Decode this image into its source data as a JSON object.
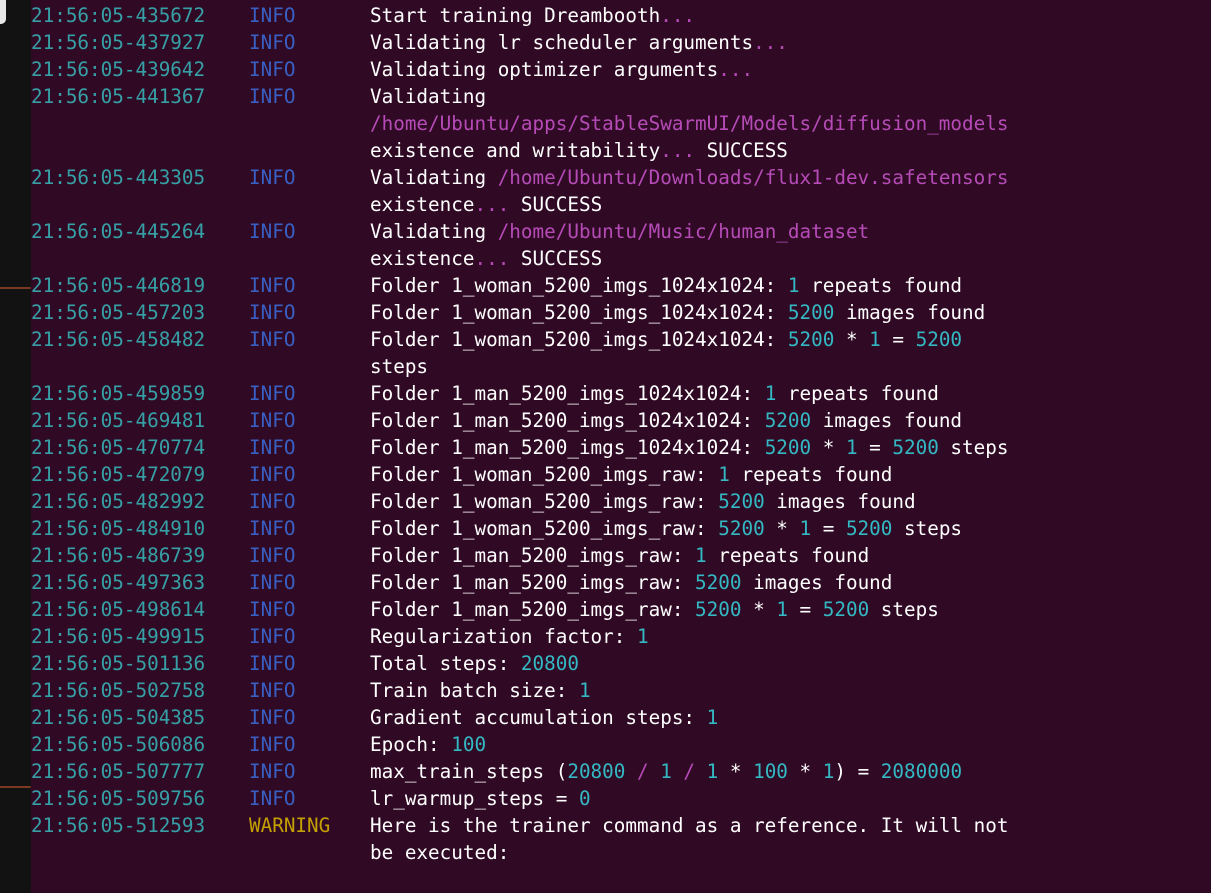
{
  "colors": {
    "background": "#300a24",
    "timestamp": "#36a0a6",
    "info": "#3a5fc2",
    "warning": "#c4a000",
    "text": "#ffffff",
    "number": "#34b8c3",
    "path": "#b64bb8"
  },
  "log": [
    {
      "time": "21:56:05-435672",
      "level": "INFO",
      "lines": [
        [
          {
            "t": "Start training Dreambooth"
          },
          {
            "t": "...",
            "c": "dim"
          }
        ]
      ]
    },
    {
      "time": "21:56:05-437927",
      "level": "INFO",
      "lines": [
        [
          {
            "t": "Validating lr scheduler arguments"
          },
          {
            "t": "...",
            "c": "dim"
          }
        ]
      ]
    },
    {
      "time": "21:56:05-439642",
      "level": "INFO",
      "lines": [
        [
          {
            "t": "Validating optimizer arguments"
          },
          {
            "t": "...",
            "c": "dim"
          }
        ]
      ]
    },
    {
      "time": "21:56:05-441367",
      "level": "INFO",
      "lines": [
        [
          {
            "t": "Validating"
          }
        ],
        [
          {
            "t": "/home/Ubuntu/apps/StableSwarmUI/Models/diffusion_models",
            "c": "path"
          }
        ],
        [
          {
            "t": "existence and writability"
          },
          {
            "t": "...",
            "c": "dim"
          },
          {
            "t": " SUCCESS"
          }
        ]
      ]
    },
    {
      "time": "21:56:05-443305",
      "level": "INFO",
      "lines": [
        [
          {
            "t": "Validating "
          },
          {
            "t": "/home/Ubuntu/Downloads/flux1-dev.safetensors",
            "c": "path"
          }
        ],
        [
          {
            "t": "existence"
          },
          {
            "t": "...",
            "c": "dim"
          },
          {
            "t": " SUCCESS"
          }
        ]
      ]
    },
    {
      "time": "21:56:05-445264",
      "level": "INFO",
      "lines": [
        [
          {
            "t": "Validating "
          },
          {
            "t": "/home/Ubuntu/Music/human_dataset",
            "c": "path"
          }
        ],
        [
          {
            "t": "existence"
          },
          {
            "t": "...",
            "c": "dim"
          },
          {
            "t": " SUCCESS"
          }
        ]
      ]
    },
    {
      "time": "21:56:05-446819",
      "level": "INFO",
      "lines": [
        [
          {
            "t": "Folder 1_woman_5200_imgs_1024x1024: "
          },
          {
            "t": "1",
            "c": "num"
          },
          {
            "t": " repeats found"
          }
        ]
      ]
    },
    {
      "time": "21:56:05-457203",
      "level": "INFO",
      "lines": [
        [
          {
            "t": "Folder 1_woman_5200_imgs_1024x1024: "
          },
          {
            "t": "5200",
            "c": "num"
          },
          {
            "t": " images found"
          }
        ]
      ]
    },
    {
      "time": "21:56:05-458482",
      "level": "INFO",
      "lines": [
        [
          {
            "t": "Folder 1_woman_5200_imgs_1024x1024: "
          },
          {
            "t": "5200",
            "c": "num"
          },
          {
            "t": " * "
          },
          {
            "t": "1",
            "c": "num"
          },
          {
            "t": " = "
          },
          {
            "t": "5200",
            "c": "num"
          }
        ],
        [
          {
            "t": "steps"
          }
        ]
      ]
    },
    {
      "time": "21:56:05-459859",
      "level": "INFO",
      "lines": [
        [
          {
            "t": "Folder 1_man_5200_imgs_1024x1024: "
          },
          {
            "t": "1",
            "c": "num"
          },
          {
            "t": " repeats found"
          }
        ]
      ]
    },
    {
      "time": "21:56:05-469481",
      "level": "INFO",
      "lines": [
        [
          {
            "t": "Folder 1_man_5200_imgs_1024x1024: "
          },
          {
            "t": "5200",
            "c": "num"
          },
          {
            "t": " images found"
          }
        ]
      ]
    },
    {
      "time": "21:56:05-470774",
      "level": "INFO",
      "lines": [
        [
          {
            "t": "Folder 1_man_5200_imgs_1024x1024: "
          },
          {
            "t": "5200",
            "c": "num"
          },
          {
            "t": " * "
          },
          {
            "t": "1",
            "c": "num"
          },
          {
            "t": " = "
          },
          {
            "t": "5200",
            "c": "num"
          },
          {
            "t": " steps"
          }
        ]
      ]
    },
    {
      "time": "21:56:05-472079",
      "level": "INFO",
      "lines": [
        [
          {
            "t": "Folder 1_woman_5200_imgs_raw: "
          },
          {
            "t": "1",
            "c": "num"
          },
          {
            "t": " repeats found"
          }
        ]
      ]
    },
    {
      "time": "21:56:05-482992",
      "level": "INFO",
      "lines": [
        [
          {
            "t": "Folder 1_woman_5200_imgs_raw: "
          },
          {
            "t": "5200",
            "c": "num"
          },
          {
            "t": " images found"
          }
        ]
      ]
    },
    {
      "time": "21:56:05-484910",
      "level": "INFO",
      "lines": [
        [
          {
            "t": "Folder 1_woman_5200_imgs_raw: "
          },
          {
            "t": "5200",
            "c": "num"
          },
          {
            "t": " * "
          },
          {
            "t": "1",
            "c": "num"
          },
          {
            "t": " = "
          },
          {
            "t": "5200",
            "c": "num"
          },
          {
            "t": " steps"
          }
        ]
      ]
    },
    {
      "time": "21:56:05-486739",
      "level": "INFO",
      "lines": [
        [
          {
            "t": "Folder 1_man_5200_imgs_raw: "
          },
          {
            "t": "1",
            "c": "num"
          },
          {
            "t": " repeats found"
          }
        ]
      ]
    },
    {
      "time": "21:56:05-497363",
      "level": "INFO",
      "lines": [
        [
          {
            "t": "Folder 1_man_5200_imgs_raw: "
          },
          {
            "t": "5200",
            "c": "num"
          },
          {
            "t": " images found"
          }
        ]
      ]
    },
    {
      "time": "21:56:05-498614",
      "level": "INFO",
      "lines": [
        [
          {
            "t": "Folder 1_man_5200_imgs_raw: "
          },
          {
            "t": "5200",
            "c": "num"
          },
          {
            "t": " * "
          },
          {
            "t": "1",
            "c": "num"
          },
          {
            "t": " = "
          },
          {
            "t": "5200",
            "c": "num"
          },
          {
            "t": " steps"
          }
        ]
      ]
    },
    {
      "time": "21:56:05-499915",
      "level": "INFO",
      "lines": [
        [
          {
            "t": "Regularization factor: "
          },
          {
            "t": "1",
            "c": "num"
          }
        ]
      ]
    },
    {
      "time": "21:56:05-501136",
      "level": "INFO",
      "lines": [
        [
          {
            "t": "Total steps: "
          },
          {
            "t": "20800",
            "c": "num"
          }
        ]
      ]
    },
    {
      "time": "21:56:05-502758",
      "level": "INFO",
      "lines": [
        [
          {
            "t": "Train batch size: "
          },
          {
            "t": "1",
            "c": "num"
          }
        ]
      ]
    },
    {
      "time": "21:56:05-504385",
      "level": "INFO",
      "lines": [
        [
          {
            "t": "Gradient accumulation steps: "
          },
          {
            "t": "1",
            "c": "num"
          }
        ]
      ]
    },
    {
      "time": "21:56:05-506086",
      "level": "INFO",
      "lines": [
        [
          {
            "t": "Epoch: "
          },
          {
            "t": "100",
            "c": "num"
          }
        ]
      ]
    },
    {
      "time": "21:56:05-507777",
      "level": "INFO",
      "lines": [
        [
          {
            "t": "max_train_steps ("
          },
          {
            "t": "20800",
            "c": "num"
          },
          {
            "t": " / ",
            "c": "dim"
          },
          {
            "t": "1",
            "c": "num"
          },
          {
            "t": " / ",
            "c": "dim"
          },
          {
            "t": "1",
            "c": "num"
          },
          {
            "t": " * "
          },
          {
            "t": "100",
            "c": "num"
          },
          {
            "t": " * "
          },
          {
            "t": "1",
            "c": "num"
          },
          {
            "t": ") = "
          },
          {
            "t": "2080000",
            "c": "num"
          }
        ]
      ]
    },
    {
      "time": "21:56:05-509756",
      "level": "INFO",
      "lines": [
        [
          {
            "t": "lr_warmup_steps = "
          },
          {
            "t": "0",
            "c": "num"
          }
        ]
      ]
    },
    {
      "time": "21:56:05-512593",
      "level": "WARNING",
      "lines": [
        [
          {
            "t": "Here is the trainer command as a reference. It will not"
          }
        ],
        [
          {
            "t": "be executed:"
          }
        ]
      ]
    }
  ]
}
